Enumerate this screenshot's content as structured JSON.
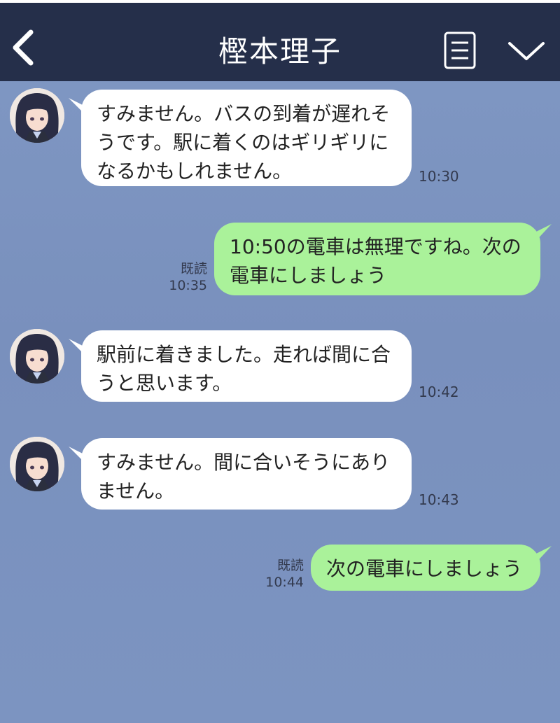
{
  "header": {
    "title": "樫本理子"
  },
  "messages": [
    {
      "direction": "incoming",
      "text": "すみません。バスの到着が遅れそ\nうです。駅に着くのはギリギリに\nなるかもしれません。",
      "time": "10:30"
    },
    {
      "direction": "outgoing",
      "text": "10:50の電車は無理ですね。次の\n電車にしましょう",
      "read": "既読",
      "time": "10:35"
    },
    {
      "direction": "incoming",
      "text": "駅前に着きました。走れば間に合\nうと思います。",
      "time": "10:42"
    },
    {
      "direction": "incoming",
      "text": "すみません。間に合いそうにあり\nません。",
      "time": "10:43"
    },
    {
      "direction": "outgoing",
      "text": "次の電車にしましょう",
      "read": "既読",
      "time": "10:44"
    }
  ],
  "colors": {
    "header_bg": "#252f4a",
    "chat_bg": "#7c94c1",
    "incoming_bubble": "#ffffff",
    "outgoing_bubble": "#aaf29a"
  }
}
